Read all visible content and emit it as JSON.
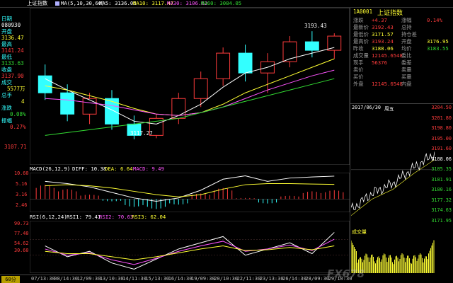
{
  "header": {
    "name": "上证指数",
    "ma_label": "MA(5,10,30,60)",
    "ma5": "MA5: 3136.05",
    "ma10": "MA10: 3117.47",
    "ma30": "MA30: 3106.62",
    "ma60": "MA60: 3084.05"
  },
  "left_panel": {
    "date_label": "日期",
    "date_value": "080930",
    "open_label": "开盘",
    "open_value": "3136.47",
    "high_label": "最高",
    "high_value": "3141.24",
    "low_label": "最低",
    "low_value": "3133.63",
    "close_label": "收盘",
    "close_value": "3137.90",
    "volume_label": "成交",
    "volume_value": "5577万",
    "amount_label": "总手",
    "amount_value": "4",
    "change_label": "涨跌",
    "change_value": "0.08%",
    "amplitude_label": "振幅",
    "amplitude_value": "0.27%",
    "bottom_price": "3107.71"
  },
  "main_chart": {
    "peak_label": "3193.43",
    "trough_label": "3117.27",
    "colors": {
      "up": "#ff3c3c",
      "down": "#33ffff",
      "ma5": "#ffffff",
      "ma10": "#ffff33",
      "ma30": "#ff55ff",
      "ma60": "#33dd33"
    }
  },
  "macd": {
    "title": "MACD(26,12,9)",
    "diff": "DIFF: 10.38",
    "dea": "DEA: 6.64",
    "macd": "MACD: 9.49",
    "ticks": [
      "10.60",
      "5.16",
      "3.16",
      "2.46"
    ]
  },
  "rsi": {
    "title": "RSI(6,12,24)",
    "rsi1": "RSI1: 79.41",
    "rsi2": "RSI2: 70.63",
    "rsi3": "RSI3: 62.04",
    "ticks": [
      "90.73",
      "77.40",
      "54.62",
      "30.60"
    ]
  },
  "time_axis": {
    "period": "60分",
    "labels": [
      "07/13:30",
      "08/14:30",
      "12/09:30",
      "13/10:30",
      "14/11:30",
      "15/13:30",
      "16/14:30",
      "19/09:30",
      "20/10:30",
      "22/11:30",
      "23/13:30",
      "26/14:30",
      "28/09:30",
      "29/10:30"
    ]
  },
  "quote_panel": {
    "code": "1A0001",
    "name": "上证指数",
    "rows": [
      {
        "l1": "涨跌",
        "v1": "+4.37",
        "l2": "涨幅",
        "v2": "0.14%",
        "c1": "red",
        "c2": "red"
      },
      {
        "l1": "最新价",
        "v1": "3192.43",
        "l2": "总持",
        "v2": "",
        "c1": "red",
        "c2": "red"
      },
      {
        "l1": "最低价",
        "v1": "3171.57",
        "l2": "持仓差",
        "v2": "",
        "c1": "yel",
        "c2": "yel"
      },
      {
        "l1": "最高价",
        "v1": "3193.24",
        "l2": "开盘",
        "v2": "3176.95",
        "c1": "red",
        "c2": "yel"
      },
      {
        "l1": "昨收",
        "v1": "3188.06",
        "l2": "均价",
        "v2": "3183.55",
        "c1": "yel",
        "c2": "grn"
      },
      {
        "l1": "成交量",
        "v1": "12145.6548",
        "l2": "委比",
        "v2": "",
        "c1": "red",
        "c2": "yel"
      },
      {
        "l1": "现手",
        "v1": "56376",
        "l2": "委差",
        "v2": "",
        "c1": "red",
        "c2": "yel"
      },
      {
        "l1": "卖价",
        "v1": "",
        "l2": "卖量",
        "v2": "",
        "c1": "yel",
        "c2": "yel"
      },
      {
        "l1": "买价",
        "v1": "",
        "l2": "买量",
        "v2": "",
        "c1": "yel",
        "c2": "yel"
      },
      {
        "l1": "外盘",
        "v1": "12145.6548",
        "l2": "内盘",
        "v2": "",
        "c1": "red",
        "c2": "yel"
      }
    ]
  },
  "intraday": {
    "date": "2017/06/30",
    "weekday": "周五",
    "ticks": [
      "3204.50",
      "3201.80",
      "3198.80",
      "3195.00",
      "3191.60",
      "3188.06",
      "3185.35",
      "3181.91",
      "3180.16",
      "3177.32",
      "3174.63",
      "3171.95"
    ],
    "volume_label": "成交量"
  },
  "watermark": {
    "text": "FX678"
  },
  "chart_data": [
    {
      "type": "candlestick",
      "title": "上证指数 60分",
      "x": [
        "07/13:30",
        "08/14:30",
        "12/09:30",
        "13/10:30",
        "14/11:30",
        "15/13:30",
        "16/14:30",
        "19/09:30",
        "20/10:30",
        "22/11:30",
        "23/13:30",
        "26/14:30",
        "28/09:30",
        "29/10:30"
      ],
      "ohlc": [
        [
          3162,
          3170,
          3145,
          3150
        ],
        [
          3150,
          3156,
          3130,
          3135
        ],
        [
          3135,
          3150,
          3128,
          3146
        ],
        [
          3146,
          3152,
          3124,
          3128
        ],
        [
          3128,
          3134,
          3117.27,
          3120
        ],
        [
          3120,
          3135,
          3118,
          3132
        ],
        [
          3132,
          3150,
          3128,
          3146
        ],
        [
          3146,
          3165,
          3140,
          3160
        ],
        [
          3160,
          3182,
          3155,
          3178
        ],
        [
          3178,
          3184,
          3158,
          3164
        ],
        [
          3164,
          3178,
          3150,
          3172
        ],
        [
          3172,
          3190,
          3168,
          3186
        ],
        [
          3186,
          3193.43,
          3175,
          3180
        ],
        [
          3180,
          3192,
          3174,
          3190
        ]
      ],
      "series": [
        {
          "name": "MA5",
          "values": [
            3160,
            3152,
            3145,
            3138,
            3130,
            3128,
            3134,
            3142,
            3154,
            3164,
            3168,
            3174,
            3178,
            3182
          ]
        },
        {
          "name": "MA10",
          "values": [
            3155,
            3152,
            3148,
            3144,
            3139,
            3135,
            3134,
            3136,
            3142,
            3150,
            3156,
            3162,
            3168,
            3174
          ]
        },
        {
          "name": "MA30",
          "values": [
            3146,
            3145,
            3143,
            3141,
            3138,
            3135,
            3134,
            3136,
            3140,
            3146,
            3152,
            3157,
            3162,
            3166
          ]
        },
        {
          "name": "MA60",
          "values": [
            3120,
            3122,
            3124,
            3126,
            3128,
            3130,
            3132,
            3136,
            3140,
            3144,
            3148,
            3152,
            3156,
            3160
          ]
        }
      ],
      "ylim": [
        3107.71,
        3200
      ]
    },
    {
      "type": "bar",
      "title": "MACD(26,12,9)",
      "x": [
        "07/13:30",
        "08/14:30",
        "12/09:30",
        "13/10:30",
        "14/11:30",
        "15/13:30",
        "16/14:30",
        "19/09:30",
        "20/10:30",
        "22/11:30",
        "23/13:30",
        "26/14:30",
        "28/09:30",
        "29/10:30"
      ],
      "values": [
        6.5,
        4.5,
        2.0,
        -1.0,
        -3.5,
        -4.5,
        -2.5,
        2.5,
        5.0,
        0.5,
        -2.0,
        1.5,
        3.5,
        4.0
      ],
      "series": [
        {
          "name": "DIFF",
          "values": [
            8.0,
            7.0,
            5.5,
            3.0,
            0.5,
            -1.0,
            0.5,
            4.0,
            9.0,
            10.5,
            8.0,
            9.5,
            10.0,
            10.38
          ]
        },
        {
          "name": "DEA",
          "values": [
            6.0,
            6.5,
            6.0,
            5.0,
            3.5,
            2.0,
            1.0,
            2.0,
            4.5,
            6.5,
            7.0,
            7.0,
            6.8,
            6.64
          ]
        }
      ],
      "ylim": [
        -5,
        11
      ]
    },
    {
      "type": "line",
      "title": "RSI(6,12,24)",
      "x": [
        "07/13:30",
        "08/14:30",
        "12/09:30",
        "13/10:30",
        "14/11:30",
        "15/13:30",
        "16/14:30",
        "19/09:30",
        "20/10:30",
        "22/11:30",
        "23/13:30",
        "26/14:30",
        "28/09:30",
        "29/10:30"
      ],
      "series": [
        {
          "name": "RSI1",
          "values": [
            62,
            48,
            55,
            40,
            32,
            45,
            58,
            66,
            74,
            50,
            58,
            66,
            52,
            79.41
          ]
        },
        {
          "name": "RSI2",
          "values": [
            58,
            50,
            53,
            44,
            38,
            46,
            55,
            62,
            68,
            55,
            58,
            63,
            56,
            70.63
          ]
        },
        {
          "name": "RSI3",
          "values": [
            55,
            52,
            52,
            48,
            44,
            48,
            53,
            58,
            62,
            56,
            57,
            60,
            57,
            62.04
          ]
        }
      ],
      "ylim": [
        30.6,
        90.73
      ]
    },
    {
      "type": "line",
      "title": "上证指数 分时",
      "x": [
        "09:30",
        "10:30",
        "11:30",
        "14:00",
        "15:00"
      ],
      "values": [
        3176.95,
        3181.5,
        3184.2,
        3188.6,
        3192.43
      ],
      "ylim": [
        3171.95,
        3204.5
      ]
    }
  ]
}
